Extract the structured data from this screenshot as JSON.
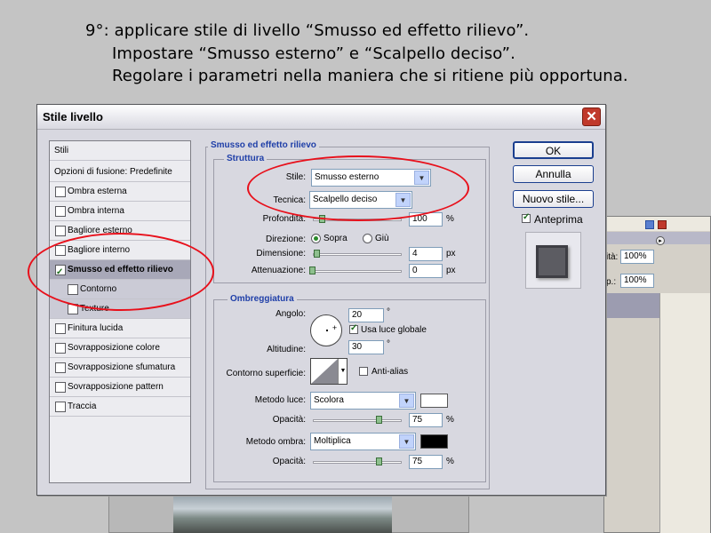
{
  "instructions": {
    "line1": "9°: applicare stile di livello “Smusso ed effetto rilievo”.",
    "line2": "Impostare  “Smusso esterno” e “Scalpello deciso”.",
    "line3": "Regolare i parametri nella maniera che si ritiene più opportuna."
  },
  "dialog": {
    "title": "Stile livello",
    "close_glyph": "✕",
    "styles_list": [
      {
        "label": "Stili",
        "checkbox": false
      },
      {
        "label": "Opzioni di fusione: Predefinite",
        "checkbox": false
      },
      {
        "label": "Ombra esterna",
        "checkbox": true,
        "checked": false
      },
      {
        "label": "Ombra interna",
        "checkbox": true,
        "checked": false
      },
      {
        "label": "Bagliore esterno",
        "checkbox": true,
        "checked": false
      },
      {
        "label": "Bagliore interno",
        "checkbox": true,
        "checked": false
      },
      {
        "label": "Smusso ed effetto rilievo",
        "checkbox": true,
        "checked": true,
        "selected": true
      },
      {
        "label": "Contorno",
        "checkbox": true,
        "checked": false,
        "sub": true
      },
      {
        "label": "Texture",
        "checkbox": true,
        "checked": false,
        "sub": true
      },
      {
        "label": "Finitura lucida",
        "checkbox": true,
        "checked": false
      },
      {
        "label": "Sovrapposizione colore",
        "checkbox": true,
        "checked": false
      },
      {
        "label": "Sovrapposizione sfumatura",
        "checkbox": true,
        "checked": false
      },
      {
        "label": "Sovrapposizione pattern",
        "checkbox": true,
        "checked": false
      },
      {
        "label": "Traccia",
        "checkbox": true,
        "checked": false
      }
    ],
    "bevel": {
      "section_title": "Smusso ed effetto rilievo",
      "structure_title": "Struttura",
      "style_label": "Stile:",
      "style_value": "Smusso esterno",
      "technique_label": "Tecnica:",
      "technique_value": "Scalpello deciso",
      "depth_label": "Profondità:",
      "depth_value": "100",
      "depth_unit": "%",
      "depth_fraction": 0.1,
      "direction_label": "Direzione:",
      "direction_up": "Sopra",
      "direction_down": "Giù",
      "size_label": "Dimensione:",
      "size_value": "4",
      "size_unit": "px",
      "soften_label": "Attenuazione:",
      "soften_value": "0",
      "soften_unit": "px"
    },
    "shading": {
      "title": "Ombreggiatura",
      "angle_label": "Angolo:",
      "angle_value": "20",
      "angle_unit": "°",
      "global_light_label": "Usa luce globale",
      "altitude_label": "Altitudine:",
      "altitude_value": "30",
      "altitude_unit": "°",
      "contour_label": "Contorno superficie:",
      "antialias_label": "Anti-alias",
      "highlight_mode_label": "Metodo luce:",
      "highlight_mode_value": "Scolora",
      "highlight_color": "#ffffff",
      "highlight_opacity_label": "Opacità:",
      "highlight_opacity_value": "75",
      "highlight_opacity_unit": "%",
      "shadow_mode_label": "Metodo ombra:",
      "shadow_mode_value": "Moltiplica",
      "shadow_color": "#000000",
      "shadow_opacity_label": "Opacità:",
      "shadow_opacity_value": "75",
      "shadow_opacity_unit": "%"
    },
    "buttons": {
      "ok": "OK",
      "cancel": "Annulla",
      "new_style": "Nuovo stile...",
      "preview_label": "Anteprima"
    }
  },
  "background_palette": {
    "field1_label": "ità:",
    "field1_value": "100%",
    "field2_label": "p.:",
    "field2_value": "100%"
  },
  "annotation_color": "#e8101b"
}
